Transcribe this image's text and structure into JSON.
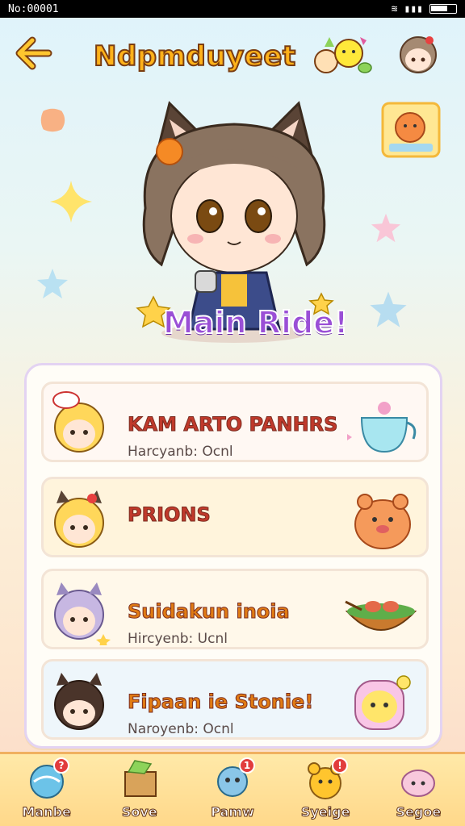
{
  "status_bar": {
    "left_text": "No:00001",
    "battery_level": 0.7
  },
  "header": {
    "title": "Ndpmduyeet"
  },
  "hero": {
    "caption": "Main Ride!"
  },
  "cards": [
    {
      "name": "KAM ARTO PANHRS",
      "subtitle": "Harcyanb: Ocnl",
      "name_color": "#c0392b",
      "bg": "#fff8f3"
    },
    {
      "name": "PRIONS",
      "subtitle": "",
      "name_color": "#c0392b",
      "bg": "#fff4dc"
    },
    {
      "name": "Suidakun inoia",
      "subtitle": "Hircyenb: Ucnl",
      "name_color": "#e07b13",
      "bg": "#fff8ea"
    },
    {
      "name": "Fipaan ie Stonie!",
      "subtitle": "Naroyenb: Ocnl",
      "name_color": "#e07b13",
      "bg": "#eef6fb"
    }
  ],
  "nav": [
    {
      "label": "Manbe",
      "badge": "?"
    },
    {
      "label": "Sove",
      "badge": ""
    },
    {
      "label": "Pamw",
      "badge": "1"
    },
    {
      "label": "Syeige",
      "badge": "!"
    },
    {
      "label": "Segoe",
      "badge": ""
    }
  ],
  "colors": {
    "accent": "#ffb21a",
    "badge_red": "#e23c3c"
  }
}
